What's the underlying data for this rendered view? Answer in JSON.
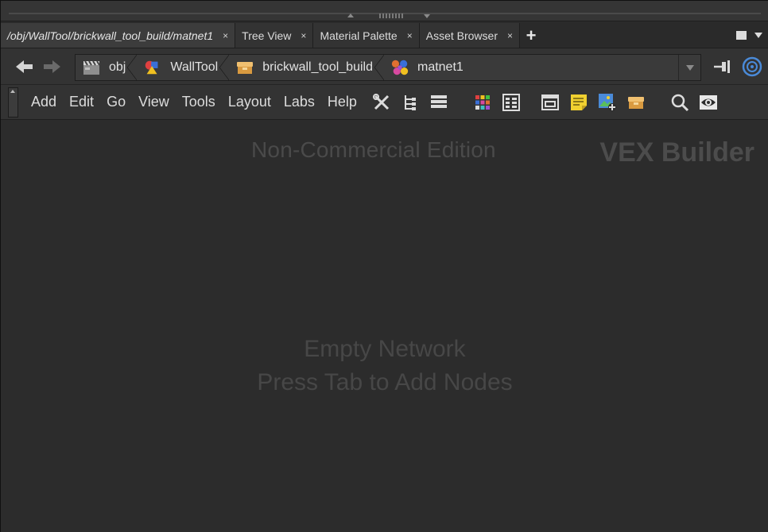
{
  "tabs": [
    {
      "label": "/obj/WallTool/brickwall_tool_build/matnet1",
      "close": "×",
      "active": true
    },
    {
      "label": "Tree View",
      "close": "×",
      "active": false
    },
    {
      "label": "Material Palette",
      "close": "×",
      "active": false
    },
    {
      "label": "Asset Browser",
      "close": "×",
      "active": false
    }
  ],
  "tab_add": "+",
  "path": [
    {
      "label": "obj",
      "icon": "obj-clapboard-icon"
    },
    {
      "label": "WallTool",
      "icon": "shapes-icon"
    },
    {
      "label": "brickwall_tool_build",
      "icon": "box-icon"
    },
    {
      "label": "matnet1",
      "icon": "material-network-icon"
    }
  ],
  "menu": [
    "Add",
    "Edit",
    "Go",
    "View",
    "Tools",
    "Layout",
    "Labs",
    "Help"
  ],
  "toolbar_icons": [
    "wrench-icon",
    "tree-icon",
    "list-icon",
    "color-grid-icon",
    "parameter-grid-icon",
    "network-box-icon",
    "sticky-note-icon",
    "image-add-icon",
    "asset-box-icon",
    "search-icon",
    "eye-icon"
  ],
  "canvas": {
    "edition": "Non-Commercial Edition",
    "context": "VEX Builder",
    "empty_line1": "Empty Network",
    "empty_line2": "Press Tab to Add Nodes"
  },
  "colors": {
    "background": "#2c2c2c",
    "toolbar": "#333333",
    "watermark": "#4a4a4a"
  }
}
